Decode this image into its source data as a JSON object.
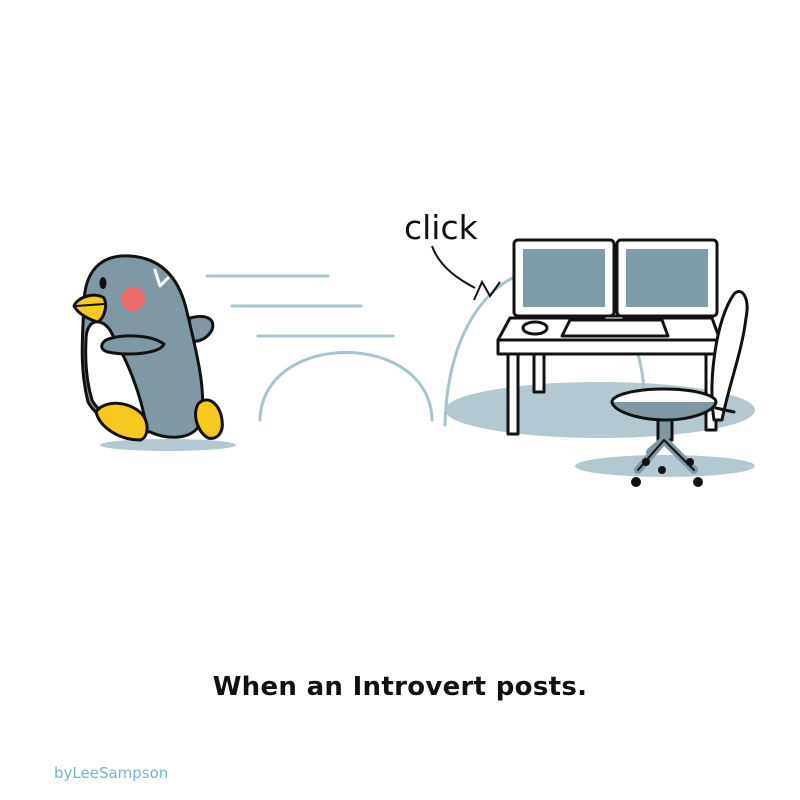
{
  "comic": {
    "sound_effect": "click",
    "caption": "When an Introvert posts.",
    "credit": "byLeeSampson"
  },
  "colors": {
    "penguin_body": "#7f98a3",
    "beak_feet": "#f7c81e",
    "cheek": "#ee6b6b",
    "screen": "#7f9ca8",
    "shadow": "#b3c8d0",
    "motion_lines": "#a8c4cf",
    "credit": "#7ab3c8"
  },
  "icons": [
    "penguin-character",
    "computer-desk",
    "dual-monitors",
    "office-chair"
  ]
}
